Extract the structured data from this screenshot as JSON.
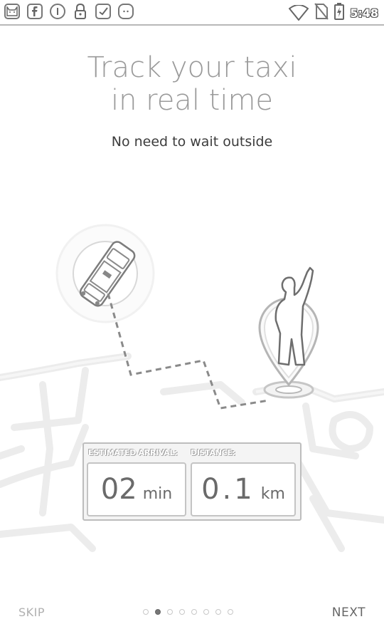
{
  "status_bar": {
    "clock": "5:48",
    "left_icons": [
      "cat-face-icon",
      "facebook-icon",
      "circle-info-icon",
      "lock-icon",
      "checkbox-icon",
      "cat-icon"
    ],
    "right_icons": [
      "wifi-icon",
      "no-sim-icon",
      "battery-charging-icon"
    ]
  },
  "onboarding": {
    "title_line1": "Track your taxi",
    "title_line2": "in real time",
    "subtitle": "No need to wait outside",
    "card": {
      "arrival_label": "ESTIMATED ARRIVAL:",
      "distance_label": "DISTANCE:",
      "arrival_value": "02",
      "arrival_unit": "min",
      "distance_value": "0.1",
      "distance_unit": "km"
    }
  },
  "navigation": {
    "skip_label": "SKIP",
    "next_label": "NEXT",
    "page_count": 8,
    "active_page": 2
  },
  "colors": {
    "title": "#9a9a9a",
    "subtitle": "#3c3c3c",
    "map_lines": "#ececec",
    "route_dash": "#8a8a8a",
    "dot_active": "#777777"
  }
}
